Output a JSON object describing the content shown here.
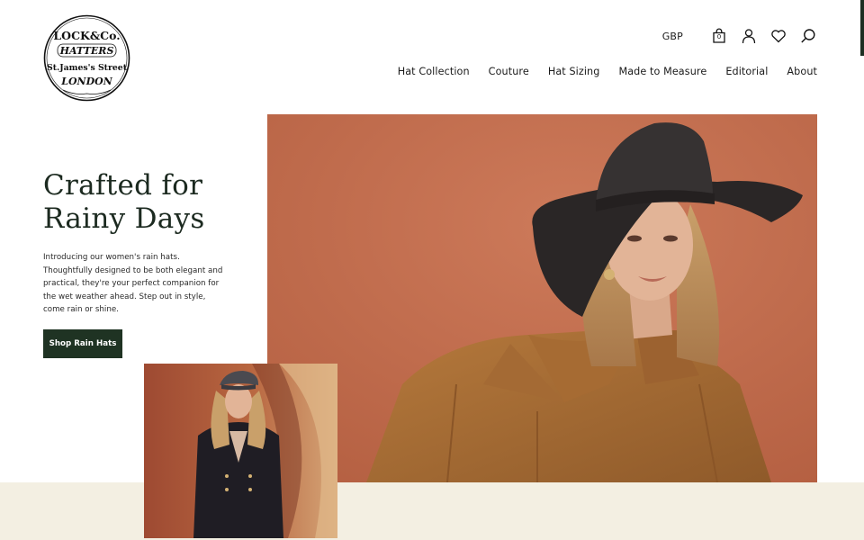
{
  "brand": {
    "logo_line1": "LOCK&Co.",
    "logo_line2": "HATTERS",
    "logo_line3": "St.James's Street",
    "logo_line4": "LONDON"
  },
  "header": {
    "currency": "GBP",
    "bag_count": "0",
    "icons": [
      "bag-icon",
      "account-icon",
      "heart-icon",
      "search-icon"
    ]
  },
  "nav": {
    "items": [
      "Hat Collection",
      "Couture",
      "Hat Sizing",
      "Made to Measure",
      "Editorial",
      "About"
    ]
  },
  "hero": {
    "title_line1": "Crafted for",
    "title_line2": "Rainy Days",
    "body": "Introducing our women's rain hats. Thoughtfully designed to be both elegant and practical, they're your perfect companion for the wet weather ahead. Step out in style, come rain or shine.",
    "cta_label": "Shop Rain Hats"
  },
  "colors": {
    "accent_dark_green": "#1f3323",
    "hero_background": "#c06a4c",
    "beige_band": "#f3efe2"
  }
}
